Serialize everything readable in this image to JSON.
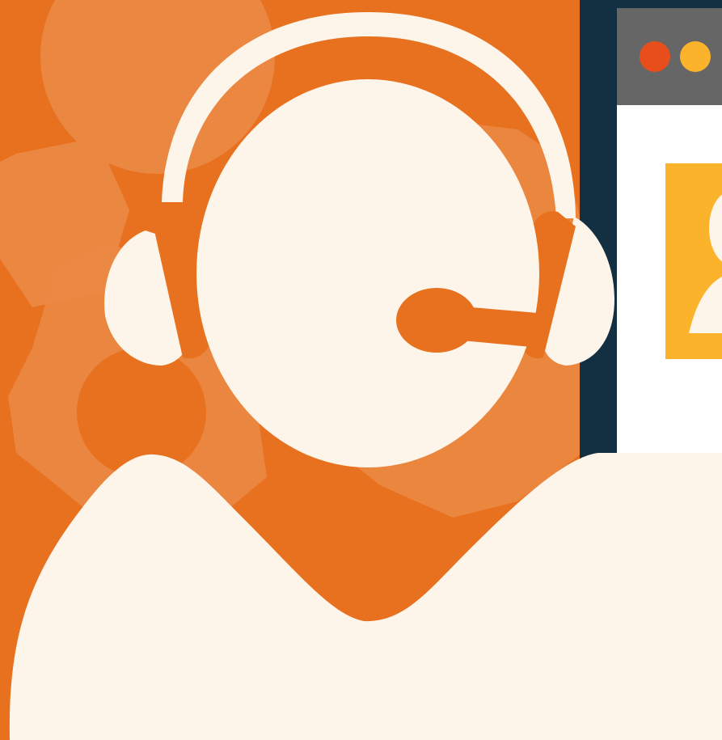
{
  "illustration": {
    "subject": "support-agent-with-headset",
    "colors": {
      "background": "#e8711f",
      "gear": "#eb8a45",
      "figure": "#fdf5ea",
      "monitor_frame": "#123042",
      "monitor_stand": "#e6e6e6",
      "window_titlebar": "#666666",
      "window_body": "#ffffff",
      "dot_close": "#e84e1c",
      "dot_minimize": "#fbb32c",
      "profile_card": "#fbb32c"
    },
    "icons": [
      "gear-icon",
      "headset-icon",
      "monitor-icon",
      "user-profile-icon"
    ]
  }
}
